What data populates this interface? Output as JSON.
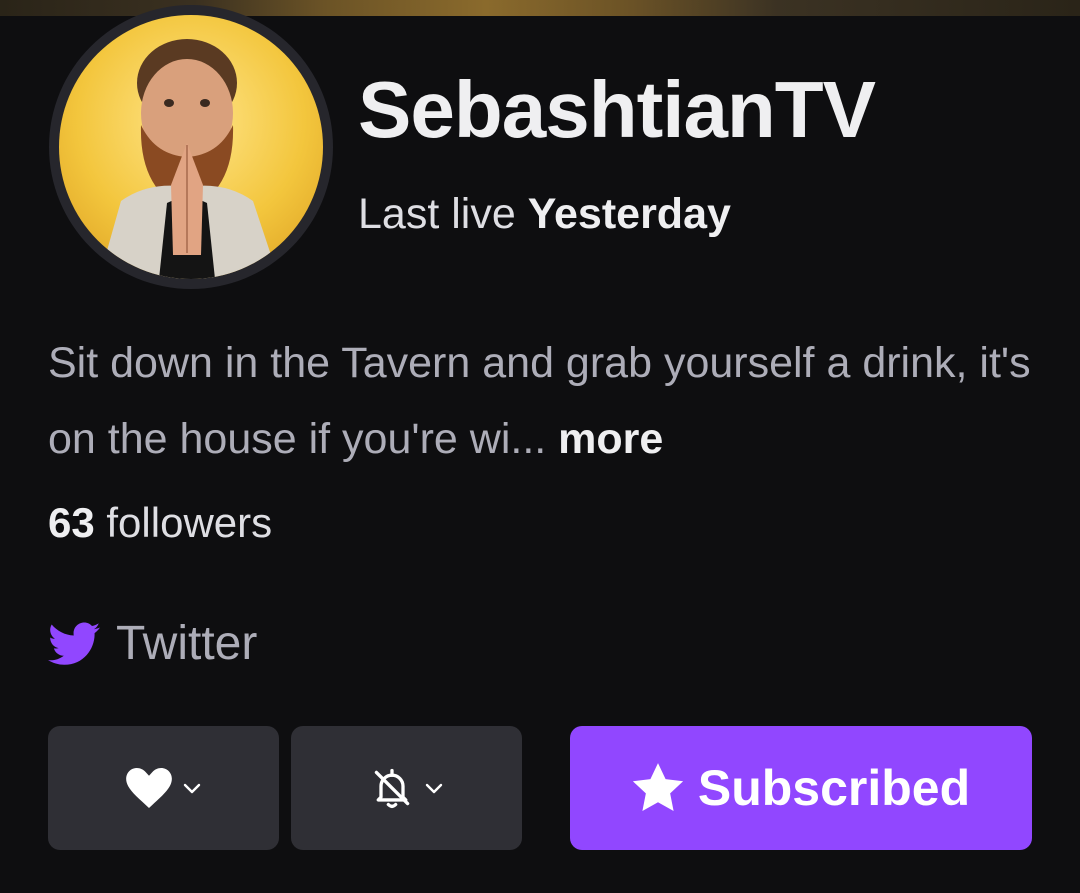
{
  "channel": {
    "name": "SebashtianTV",
    "last_live_label": "Last live",
    "last_live_value": "Yesterday",
    "avatar_icon": "avatar-photo"
  },
  "bio": {
    "text": "Sit down in the Tavern and grab yourself a drink, it's on the house if you're wi...",
    "more_label": "more"
  },
  "followers": {
    "count": "63",
    "label": "followers"
  },
  "social": {
    "icon": "twitter-icon",
    "label": "Twitter"
  },
  "actions": {
    "follow_icon": "heart-icon",
    "notify_icon": "bell-off-icon",
    "subscribe_icon": "star-icon",
    "subscribe_label": "Subscribed"
  },
  "colors": {
    "background": "#0e0e10",
    "accent": "#9147ff",
    "button_gray": "#2f2f35",
    "muted_text": "#adadb8"
  }
}
